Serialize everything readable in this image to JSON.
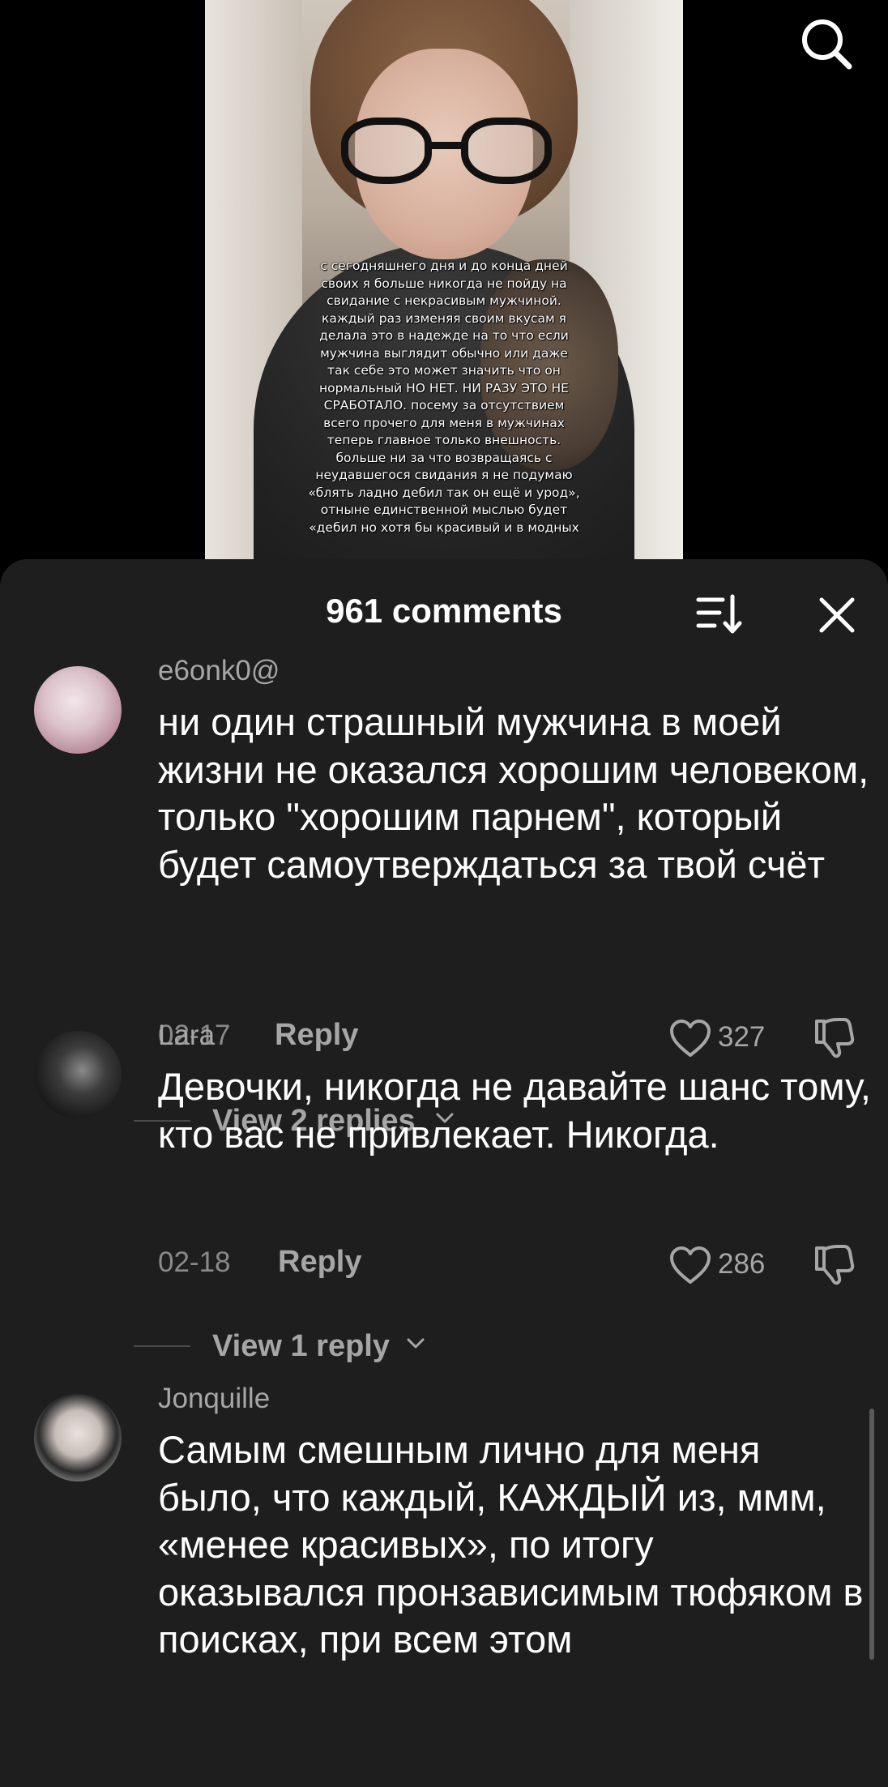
{
  "video": {
    "overlay_text": "с сегодняшнего дня и до конца дней\nсвоих я больше никогда не пойду на\nсвидание с некрасивым мужчиной.\nкаждый раз изменяя своим вкусам я\nделала это в надежде на то что если\nмужчина выглядит обычно или даже\nтак себе это может значить что он\nнормальный НО НЕТ. НИ РАЗУ ЭТО НЕ\nСРАБОТАЛО. посему за отсутствием\nвсего прочего для меня в мужчинах\nтеперь главное только внешность.\nбольше ни за что возвращаясь с\nнеудавшегося свидания я не подумаю\n«блять ладно дебил так он ещё и урод»,\nотныне единственной мыслью будет\n«дебил но хотя бы красивый и в модных",
    "search_icon": "search-icon"
  },
  "comments_sheet": {
    "count_label": "961 comments",
    "sort_icon": "sort-icon",
    "close_icon": "close-icon",
    "comments": [
      {
        "username": "e6onk0@",
        "text": "ни один страшный мужчина в моей жизни не оказался хорошим человеком, только \"хорошим парнем\", который будет самоутверждаться за твой счёт",
        "date": "02-17",
        "reply_label": "Reply",
        "likes": "327",
        "view_replies": "View 2 replies"
      },
      {
        "username": "Lara",
        "text": "Девочки, никогда не давайте шанс тому, кто вас не привлекает. Никогда.",
        "date": "02-18",
        "reply_label": "Reply",
        "likes": "286",
        "view_replies": "View 1 reply"
      },
      {
        "username": "Jonquille",
        "text": "Самым смешным лично для меня было, что каждый, КАЖДЫЙ из, ммм, «менее красивых», по итогу оказывался пронзависимым тюфяком в поисках, при всем этом"
      }
    ]
  },
  "colors": {
    "sheet_bg": "#1e1e1e",
    "muted_text": "#a6a6a6",
    "date_text": "#8a8a8a"
  }
}
